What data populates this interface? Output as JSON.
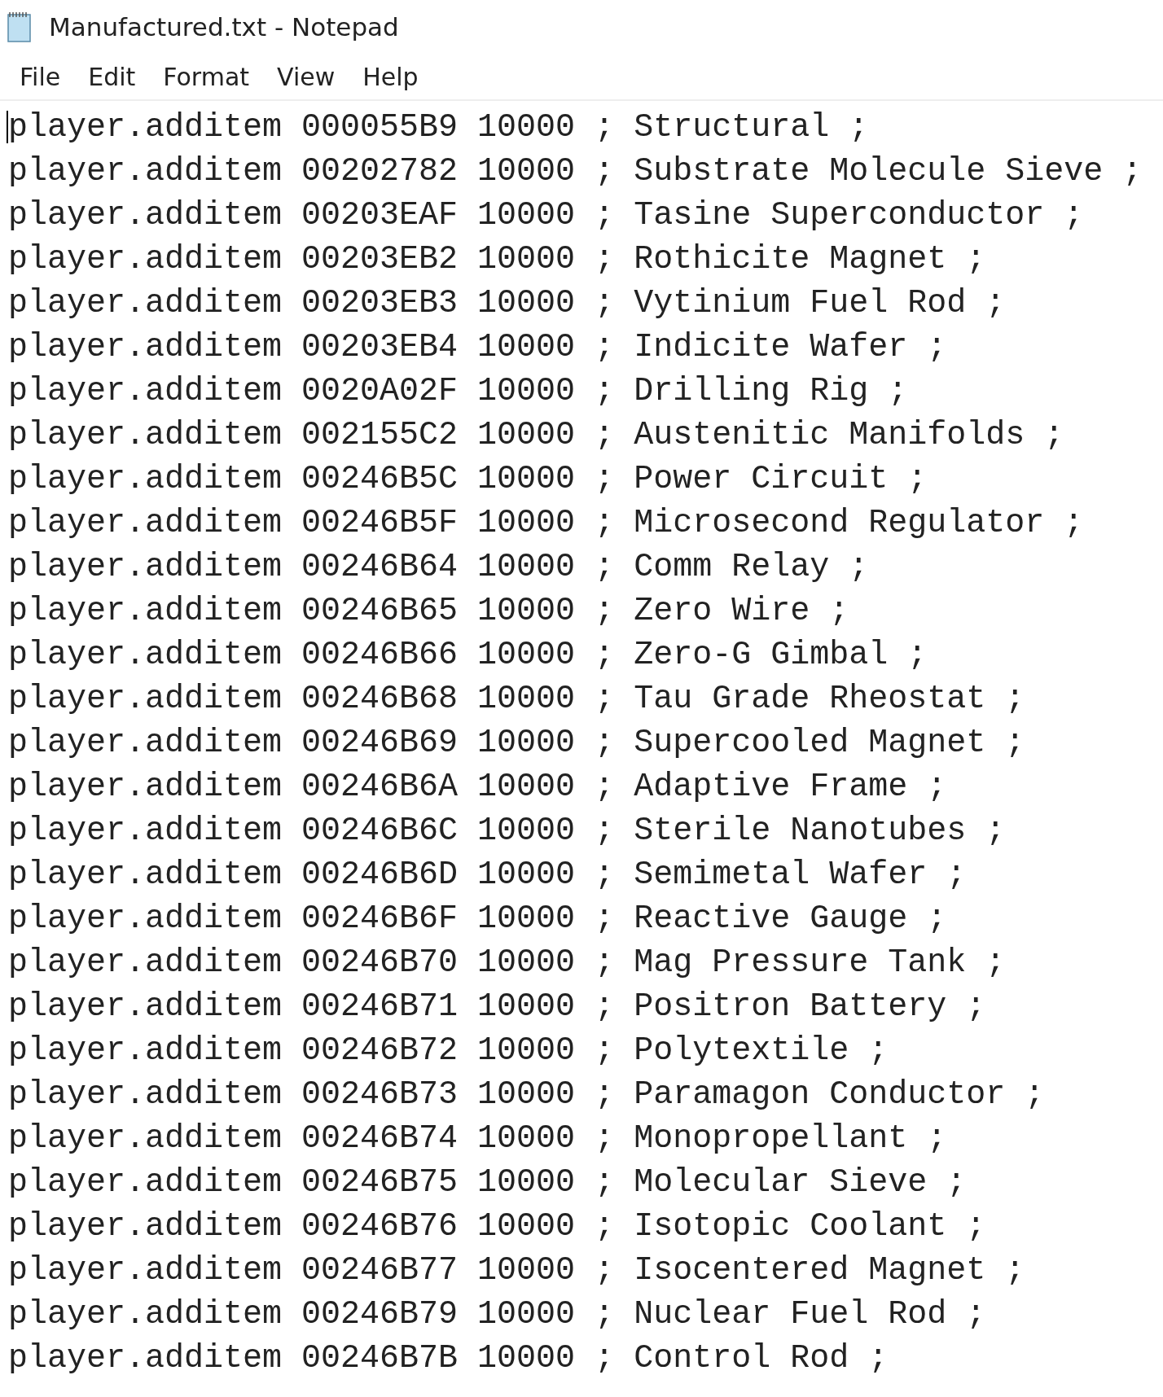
{
  "window": {
    "title": "Manufactured.txt - Notepad"
  },
  "menu": [
    "File",
    "Edit",
    "Format",
    "View",
    "Help"
  ],
  "lines": [
    "player.additem 000055B9 10000 ; Structural ;",
    "player.additem 00202782 10000 ; Substrate Molecule Sieve ;",
    "player.additem 00203EAF 10000 ; Tasine Superconductor ;",
    "player.additem 00203EB2 10000 ; Rothicite Magnet ;",
    "player.additem 00203EB3 10000 ; Vytinium Fuel Rod ;",
    "player.additem 00203EB4 10000 ; Indicite Wafer ;",
    "player.additem 0020A02F 10000 ; Drilling Rig ;",
    "player.additem 002155C2 10000 ; Austenitic Manifolds ;",
    "player.additem 00246B5C 10000 ; Power Circuit ;",
    "player.additem 00246B5F 10000 ; Microsecond Regulator ;",
    "player.additem 00246B64 10000 ; Comm Relay ;",
    "player.additem 00246B65 10000 ; Zero Wire ;",
    "player.additem 00246B66 10000 ; Zero-G Gimbal ;",
    "player.additem 00246B68 10000 ; Tau Grade Rheostat ;",
    "player.additem 00246B69 10000 ; Supercooled Magnet ;",
    "player.additem 00246B6A 10000 ; Adaptive Frame ;",
    "player.additem 00246B6C 10000 ; Sterile Nanotubes ;",
    "player.additem 00246B6D 10000 ; Semimetal Wafer ;",
    "player.additem 00246B6F 10000 ; Reactive Gauge ;",
    "player.additem 00246B70 10000 ; Mag Pressure Tank ;",
    "player.additem 00246B71 10000 ; Positron Battery ;",
    "player.additem 00246B72 10000 ; Polytextile ;",
    "player.additem 00246B73 10000 ; Paramagon Conductor ;",
    "player.additem 00246B74 10000 ; Monopropellant ;",
    "player.additem 00246B75 10000 ; Molecular Sieve ;",
    "player.additem 00246B76 10000 ; Isotopic Coolant ;",
    "player.additem 00246B77 10000 ; Isocentered Magnet ;",
    "player.additem 00246B79 10000 ; Nuclear Fuel Rod ;",
    "player.additem 00246B7B 10000 ; Control Rod ;"
  ]
}
